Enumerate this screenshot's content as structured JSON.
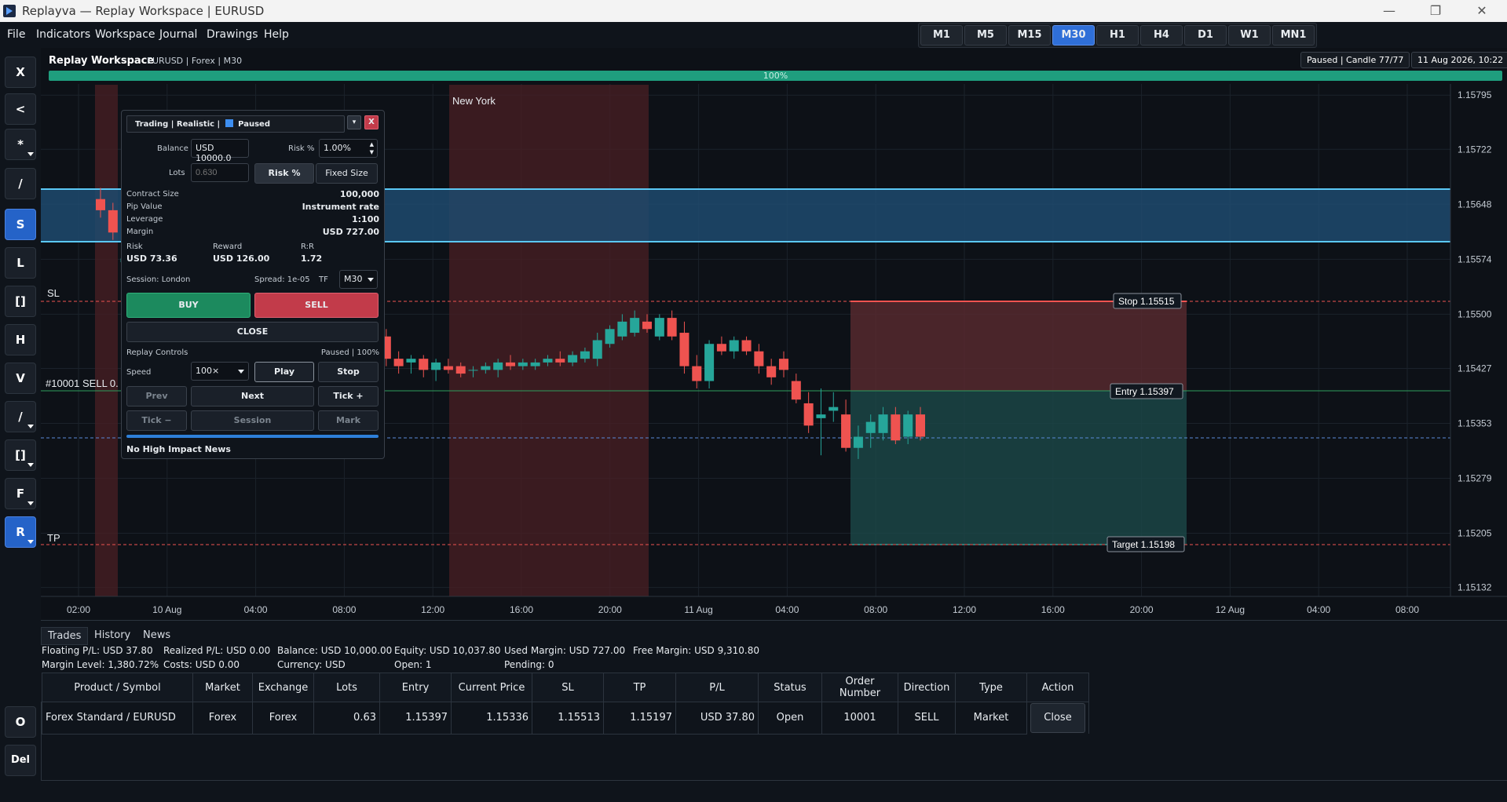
{
  "window": {
    "title": "Replayva — Replay Workspace | EURUSD",
    "minimize": "—",
    "maximize": "❐",
    "close": "✕"
  },
  "menu": [
    "File",
    "Indicators",
    "Workspace",
    "Journal",
    "Drawings",
    "Help"
  ],
  "timeframes": [
    "M1",
    "M5",
    "M15",
    "M30",
    "H1",
    "H4",
    "D1",
    "W1",
    "MN1"
  ],
  "active_timeframe": "M30",
  "toolbar": [
    "X",
    "<",
    "*",
    "/",
    "S",
    "L",
    "[]",
    "H",
    "V",
    "/",
    "[]",
    "F",
    "R"
  ],
  "toolbar_bottom": [
    "O",
    "Del"
  ],
  "header": {
    "title": "Replay Workspace",
    "subtitle": "EURUSD | Forex | M30",
    "status": "Paused | Candle 77/77",
    "datetime": "11 Aug 2026, 10:22"
  },
  "progress": {
    "label": "100%",
    "fraction": 1.0
  },
  "chart": {
    "session_label": "New York",
    "price_axis": [
      "1.15795",
      "1.15722",
      "1.15648",
      "1.15574",
      "1.15500",
      "1.15427",
      "1.15353",
      "1.15279",
      "1.15205",
      "1.15132"
    ],
    "time_axis": [
      "02:00",
      "10 Aug",
      "04:00",
      "08:00",
      "12:00",
      "16:00",
      "20:00",
      "11 Aug",
      "04:00",
      "08:00",
      "12:00",
      "16:00",
      "20:00",
      "12 Aug",
      "04:00",
      "08:00"
    ],
    "sl_label": "SL",
    "tp_label": "TP",
    "order_label": "#10001 SELL 0.",
    "stop_tag": "Stop 1.15515",
    "entry_tag": "Entry 1.15397",
    "target_tag": "Target 1.15198",
    "colors": {
      "up": "#26a69a",
      "down": "#ef5350",
      "zone": "#1f4a6e"
    }
  },
  "panel": {
    "title": "Trading | Realistic |",
    "status": "Paused",
    "balance_label": "Balance",
    "balance_value": "USD 10000.0",
    "risk_label": "Risk %",
    "risk_value": "1.00%",
    "lots_label": "Lots",
    "lots_placeholder": "0.630",
    "mode_risk": "Risk %",
    "mode_fixed": "Fixed Size",
    "contract_size_label": "Contract Size",
    "contract_size": "100,000",
    "pip_value_label": "Pip Value",
    "pip_value": "Instrument rate",
    "leverage_label": "Leverage",
    "leverage": "1:100",
    "margin_label": "Margin",
    "margin": "USD 727.00",
    "risk_h": "Risk",
    "reward_h": "Reward",
    "rr_h": "R:R",
    "risk_amt": "USD 73.36",
    "reward_amt": "USD 126.00",
    "rr": "1.72",
    "session": "Session: London",
    "spread": "Spread: 1e-05",
    "tf_label": "TF",
    "tf_value": "M30",
    "buy": "BUY",
    "sell": "SELL",
    "close": "CLOSE",
    "replay_controls": "Replay Controls",
    "replay_status": "Paused | 100%",
    "speed_label": "Speed",
    "speed_value": "100×",
    "play": "Play",
    "stop": "Stop",
    "prev": "Prev",
    "next": "Next",
    "tick_plus": "Tick +",
    "tick_minus": "Tick −",
    "session_btn": "Session",
    "mark": "Mark",
    "news": "No High Impact News"
  },
  "bottom": {
    "tabs": [
      "Trades",
      "History",
      "News"
    ],
    "stats_row1": [
      "Floating P/L: USD 37.80",
      "Realized P/L: USD 0.00",
      "Balance: USD 10,000.00",
      "Equity: USD 10,037.80",
      "Used Margin: USD 727.00",
      "Free Margin: USD 9,310.80"
    ],
    "stats_row2": [
      "Margin Level: 1,380.72%",
      "Costs: USD 0.00",
      "Currency: USD",
      "Open: 1",
      "Pending: 0"
    ],
    "columns": [
      "Product / Symbol",
      "Market",
      "Exchange",
      "Lots",
      "Entry",
      "Current Price",
      "SL",
      "TP",
      "P/L",
      "Status",
      "Order Number",
      "Direction",
      "Type",
      "Action"
    ],
    "row": [
      "Forex Standard / EURUSD",
      "Forex",
      "Forex",
      "0.63",
      "1.15397",
      "1.15336",
      "1.15513",
      "1.15197",
      "USD 37.80",
      "Open",
      "10001",
      "SELL",
      "Market"
    ],
    "row_action": "Close"
  },
  "candles": [
    [
      1.15655,
      1.1567,
      1.1563,
      1.1564
    ],
    [
      1.1564,
      1.1565,
      1.156,
      1.1561
    ],
    [
      1.1557,
      1.15585,
      1.1556,
      1.15575
    ],
    [
      1.15575,
      1.1559,
      1.15545,
      1.1555
    ],
    [
      1.1555,
      1.15565,
      1.15535,
      1.15545
    ],
    [
      1.1556,
      1.1558,
      1.1555,
      1.1557
    ],
    [
      1.15575,
      1.1559,
      1.15545,
      1.15555
    ],
    [
      1.1556,
      1.1557,
      1.1552,
      1.1553
    ],
    [
      1.15565,
      1.15575,
      1.1555,
      1.1556
    ],
    [
      1.1556,
      1.1557,
      1.1551,
      1.1552
    ],
    [
      1.1552,
      1.1553,
      1.1548,
      1.1549
    ],
    [
      1.1551,
      1.15525,
      1.15505,
      1.15515
    ],
    [
      1.15515,
      1.15525,
      1.1548,
      1.15485
    ],
    [
      1.1549,
      1.155,
      1.1545,
      1.1546
    ],
    [
      1.1547,
      1.1553,
      1.15465,
      1.1552
    ],
    [
      1.15525,
      1.15535,
      1.1544,
      1.1545
    ],
    [
      1.1546,
      1.15535,
      1.15455,
      1.1553
    ],
    [
      1.1553,
      1.15535,
      1.15495,
      1.15505
    ],
    [
      1.15505,
      1.1553,
      1.155,
      1.1552
    ],
    [
      1.1552,
      1.15525,
      1.15475,
      1.15485
    ],
    [
      1.1549,
      1.15525,
      1.15485,
      1.15515
    ],
    [
      1.15515,
      1.1553,
      1.15505,
      1.15525
    ],
    [
      1.15525,
      1.1553,
      1.1546,
      1.1547
    ],
    [
      1.1547,
      1.1548,
      1.1543,
      1.1544
    ],
    [
      1.1544,
      1.1545,
      1.1542,
      1.1543
    ],
    [
      1.15435,
      1.15445,
      1.1542,
      1.1544
    ],
    [
      1.1544,
      1.15445,
      1.15415,
      1.15425
    ],
    [
      1.15425,
      1.1544,
      1.1541,
      1.15435
    ],
    [
      1.1543,
      1.1544,
      1.1542,
      1.15425
    ],
    [
      1.1543,
      1.15435,
      1.15415,
      1.1542
    ],
    [
      1.15425,
      1.1543,
      1.15415,
      1.15425
    ],
    [
      1.15425,
      1.15435,
      1.1542,
      1.1543
    ],
    [
      1.15425,
      1.1544,
      1.15415,
      1.15435
    ],
    [
      1.15435,
      1.15445,
      1.15425,
      1.1543
    ],
    [
      1.1543,
      1.1544,
      1.15425,
      1.15435
    ],
    [
      1.1543,
      1.1544,
      1.15425,
      1.15435
    ],
    [
      1.15435,
      1.15445,
      1.1543,
      1.1544
    ],
    [
      1.1544,
      1.1545,
      1.1543,
      1.15435
    ],
    [
      1.15435,
      1.1545,
      1.1543,
      1.15445
    ],
    [
      1.1544,
      1.15455,
      1.15435,
      1.1545
    ],
    [
      1.1544,
      1.15475,
      1.1543,
      1.15465
    ],
    [
      1.1546,
      1.15485,
      1.15455,
      1.1548
    ],
    [
      1.1547,
      1.155,
      1.15465,
      1.1549
    ],
    [
      1.15475,
      1.15505,
      1.1547,
      1.15495
    ],
    [
      1.1549,
      1.155,
      1.15475,
      1.1548
    ],
    [
      1.1547,
      1.155,
      1.15465,
      1.15495
    ],
    [
      1.15495,
      1.15505,
      1.15465,
      1.1547
    ],
    [
      1.15475,
      1.1549,
      1.1542,
      1.1543
    ],
    [
      1.1543,
      1.15445,
      1.154,
      1.1541
    ],
    [
      1.1541,
      1.15465,
      1.154,
      1.1546
    ],
    [
      1.1546,
      1.1547,
      1.15445,
      1.1545
    ],
    [
      1.1545,
      1.1547,
      1.1544,
      1.15465
    ],
    [
      1.15465,
      1.1547,
      1.15445,
      1.1545
    ],
    [
      1.1545,
      1.1546,
      1.1542,
      1.1543
    ],
    [
      1.1543,
      1.1544,
      1.15405,
      1.15415
    ],
    [
      1.1544,
      1.1545,
      1.15415,
      1.15425
    ],
    [
      1.1541,
      1.1542,
      1.1538,
      1.15385
    ],
    [
      1.1538,
      1.15395,
      1.1534,
      1.1535
    ],
    [
      1.1536,
      1.154,
      1.1531,
      1.15365
    ],
    [
      1.1537,
      1.15395,
      1.15355,
      1.15375
    ],
    [
      1.15365,
      1.15385,
      1.15315,
      1.1532
    ],
    [
      1.1532,
      1.1535,
      1.15305,
      1.15335
    ],
    [
      1.1534,
      1.15365,
      1.1532,
      1.15355
    ],
    [
      1.1534,
      1.15375,
      1.1533,
      1.15365
    ],
    [
      1.15365,
      1.15375,
      1.15325,
      1.1533
    ],
    [
      1.15335,
      1.1537,
      1.15325,
      1.15365
    ],
    [
      1.15365,
      1.15375,
      1.1533,
      1.15335
    ]
  ]
}
